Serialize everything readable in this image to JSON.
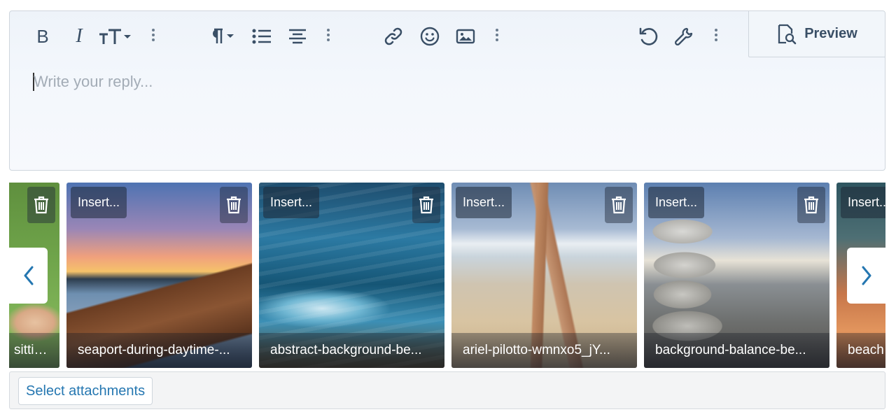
{
  "editor": {
    "placeholder": "Write your reply...",
    "toolbar": {
      "bold_label": "B",
      "italic_label": "I",
      "preview_label": "Preview"
    }
  },
  "attachments": {
    "items": [
      {
        "insert_label": "",
        "filename": "sittin..."
      },
      {
        "insert_label": "Insert...",
        "filename": "seaport-during-daytime-..."
      },
      {
        "insert_label": "Insert...",
        "filename": "abstract-background-be..."
      },
      {
        "insert_label": "Insert...",
        "filename": "ariel-pilotto-wmnxo5_jY..."
      },
      {
        "insert_label": "Insert...",
        "filename": "background-balance-be..."
      },
      {
        "insert_label": "Insert...",
        "filename": "beach"
      }
    ],
    "select_label": "Select attachments"
  },
  "colors": {
    "toolbar_icon": "#3a4f66",
    "link_blue": "#2577b1",
    "placeholder": "#a3acb6"
  },
  "icons": [
    "bold-icon",
    "italic-icon",
    "text-size-icon",
    "more-icon",
    "paragraph-icon",
    "bullet-list-icon",
    "align-icon",
    "link-icon",
    "emoji-icon",
    "image-icon",
    "undo-icon",
    "wrench-icon",
    "preview-icon",
    "trash-icon",
    "chevron-left-icon",
    "chevron-right-icon"
  ]
}
